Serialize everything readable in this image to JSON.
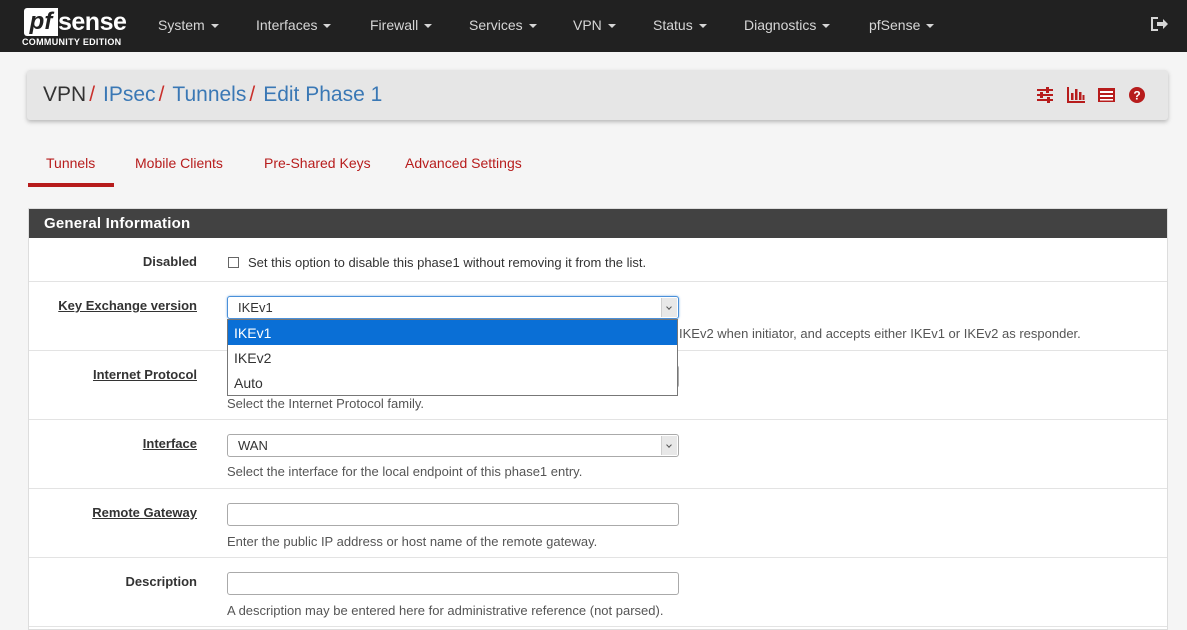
{
  "brand": {
    "logo_pf": "pf",
    "logo_sense": "sense",
    "edition": "COMMUNITY EDITION"
  },
  "nav": {
    "items": [
      "System",
      "Interfaces",
      "Firewall",
      "Services",
      "VPN",
      "Status",
      "Diagnostics",
      "pfSense"
    ]
  },
  "breadcrumb": {
    "root": "VPN",
    "sep": "/",
    "links": [
      "IPsec",
      "Tunnels",
      "Edit Phase 1"
    ]
  },
  "tabs": [
    "Tunnels",
    "Mobile Clients",
    "Pre-Shared Keys",
    "Advanced Settings"
  ],
  "panel": {
    "title": "General Information",
    "disabled": {
      "label": "Disabled",
      "text": "Set this option to disable this phase1 without removing it from the list."
    },
    "key_exchange": {
      "label": "Key Exchange version",
      "value": "IKEv1",
      "options": [
        "IKEv1",
        "IKEv2",
        "Auto"
      ],
      "help_visible": "IKEv2 when initiator, and accepts either IKEv1 or IKEv2 as responder."
    },
    "internet_protocol": {
      "label": "Internet Protocol",
      "help": "Select the Internet Protocol family."
    },
    "interface": {
      "label": "Interface",
      "value": "WAN",
      "help": "Select the interface for the local endpoint of this phase1 entry."
    },
    "remote_gateway": {
      "label": "Remote Gateway",
      "value": "",
      "help": "Enter the public IP address or host name of the remote gateway."
    },
    "description": {
      "label": "Description",
      "value": "",
      "help": "A description may be entered here for administrative reference (not parsed)."
    }
  },
  "colors": {
    "navbar": "#212121",
    "accent_red": "#b71c1c",
    "link_blue": "#3a78b5",
    "selected_option": "#0a6fd6",
    "panel_heading": "#424242"
  },
  "icons": [
    "sliders-icon",
    "bar-chart-icon",
    "list-icon",
    "help-icon",
    "logout-icon"
  ]
}
